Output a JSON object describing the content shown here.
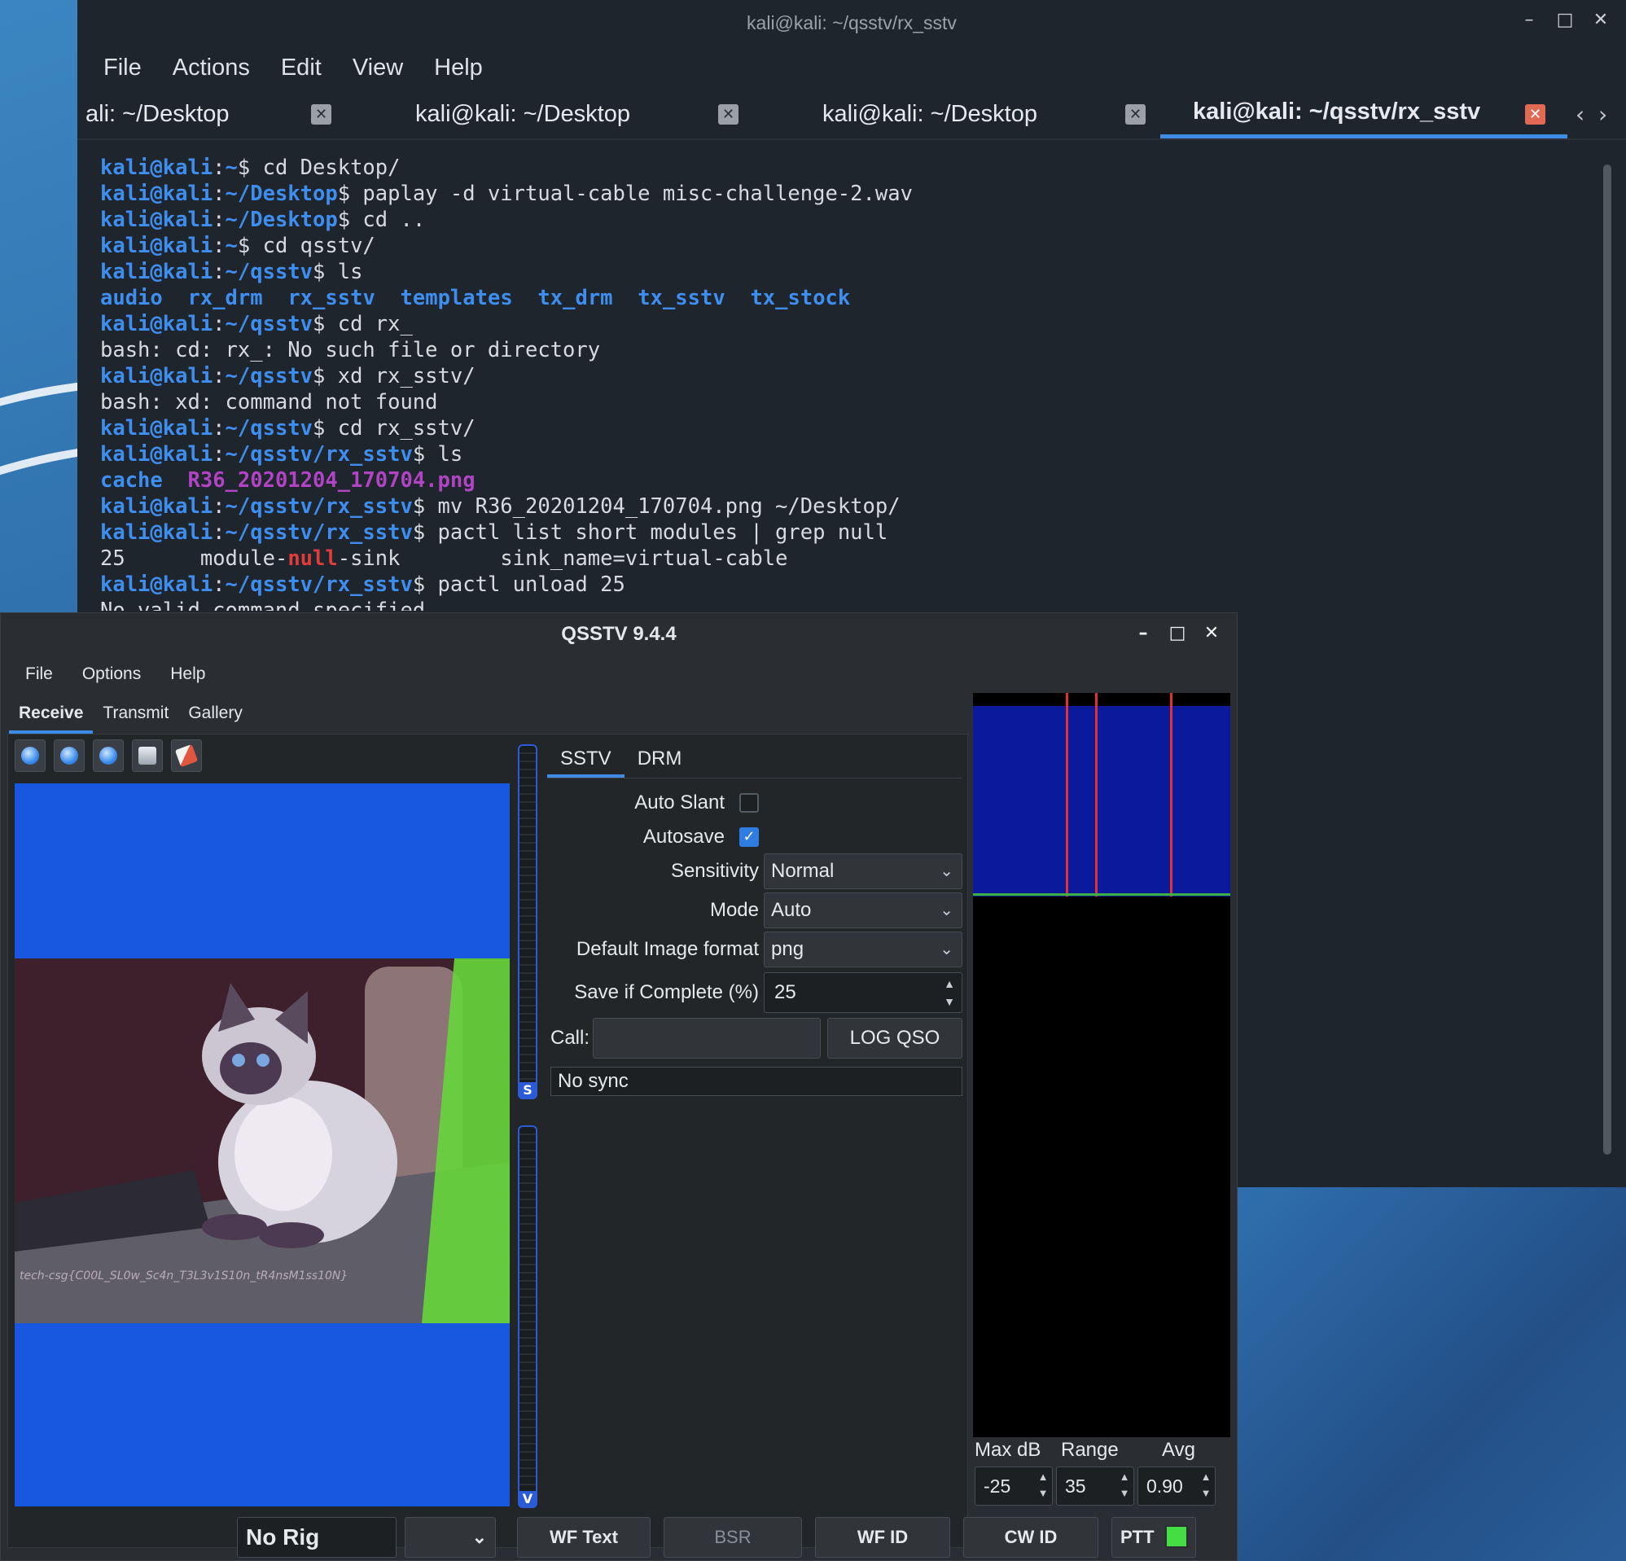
{
  "terminal": {
    "title": "kali@kali: ~/qsstv/rx_sstv",
    "menu": [
      "File",
      "Actions",
      "Edit",
      "View",
      "Help"
    ],
    "tabs": [
      {
        "label": "ali: ~/Desktop",
        "active": false
      },
      {
        "label": "kali@kali: ~/Desktop",
        "active": false
      },
      {
        "label": "kali@kali: ~/Desktop",
        "active": false
      },
      {
        "label": "kali@kali: ~/qsstv/rx_sstv",
        "active": true
      }
    ],
    "prompt_user": "kali@kali",
    "lines": [
      {
        "path": "~",
        "cmd": " cd Desktop/"
      },
      {
        "path": "~/Desktop",
        "cmd": " paplay -d virtual-cable misc-challenge-2.wav"
      },
      {
        "path": "~/Desktop",
        "cmd": " cd .."
      },
      {
        "path": "~",
        "cmd": " cd qsstv/"
      },
      {
        "path": "~/qsstv",
        "cmd": " ls"
      },
      {
        "path": "~/qsstv",
        "cmd": " cd rx_"
      },
      {
        "path": "~/qsstv",
        "cmd": " xd rx_sstv/"
      },
      {
        "path": "~/qsstv",
        "cmd": " cd rx_sstv/"
      },
      {
        "path": "~/qsstv/rx_sstv",
        "cmd": " ls"
      },
      {
        "path": "~/qsstv/rx_sstv",
        "cmd": " mv R36_20201204_170704.png ~/Desktop/"
      },
      {
        "path": "~/qsstv/rx_sstv",
        "cmd": " pactl list short modules | grep null"
      },
      {
        "path": "~/qsstv/rx_sstv",
        "cmd": " pactl unload 25"
      }
    ],
    "ls_qsstv": [
      "audio",
      "rx_drm",
      "rx_sstv",
      "templates",
      "tx_drm",
      "tx_sstv",
      "tx_stock"
    ],
    "err_cd": "bash: cd: rx_: No such file or directory",
    "err_xd": "bash: xd: command not found",
    "ls_rx": {
      "dir": "cache",
      "file": "R36_20201204_170704.png"
    },
    "module_line": {
      "id": "25",
      "pre": "module-",
      "hl": "null",
      "post": "-sink",
      "sink": "sink_name=virtual-cable"
    },
    "last_line": "No valid command specified"
  },
  "qsstv": {
    "title": "QSSTV 9.4.4",
    "menu": [
      "File",
      "Options",
      "Help"
    ],
    "tabs": [
      "Receive",
      "Transmit",
      "Gallery"
    ],
    "flag_text": "tech-csg{C00L_SL0w_Sc4n_T3L3v1S10n_tR4nsM1ss10N}",
    "vu_top_label": "S",
    "vu_bottom_label": "V",
    "settings_tabs": [
      "SSTV",
      "DRM"
    ],
    "auto_slant_label": "Auto Slant",
    "auto_slant_checked": false,
    "autosave_label": "Autosave",
    "autosave_checked": true,
    "sensitivity_label": "Sensitivity",
    "sensitivity_value": "Normal",
    "mode_label": "Mode",
    "mode_value": "Auto",
    "image_format_label": "Default Image format",
    "image_format_value": "png",
    "save_complete_label": "Save if Complete (%)",
    "save_complete_value": "25",
    "call_label": "Call:",
    "call_value": "",
    "log_qso_label": "LOG QSO",
    "status_text": "No sync",
    "maxdb_label": "Max dB",
    "range_label": "Range",
    "avg_label": "Avg",
    "maxdb_value": "-25",
    "range_value": "35",
    "avg_value": "0.90",
    "statusbar": {
      "rig": "No Rig",
      "wf_text": "WF Text",
      "bsr": "BSR",
      "wf_id": "WF ID",
      "cw_id": "CW ID",
      "ptt": "PTT"
    },
    "colors": {
      "accent": "#3f8ce6",
      "image_bg": "#1857e0",
      "ptt_on": "#44dd44",
      "spectrum": "#0a1a9a"
    }
  }
}
